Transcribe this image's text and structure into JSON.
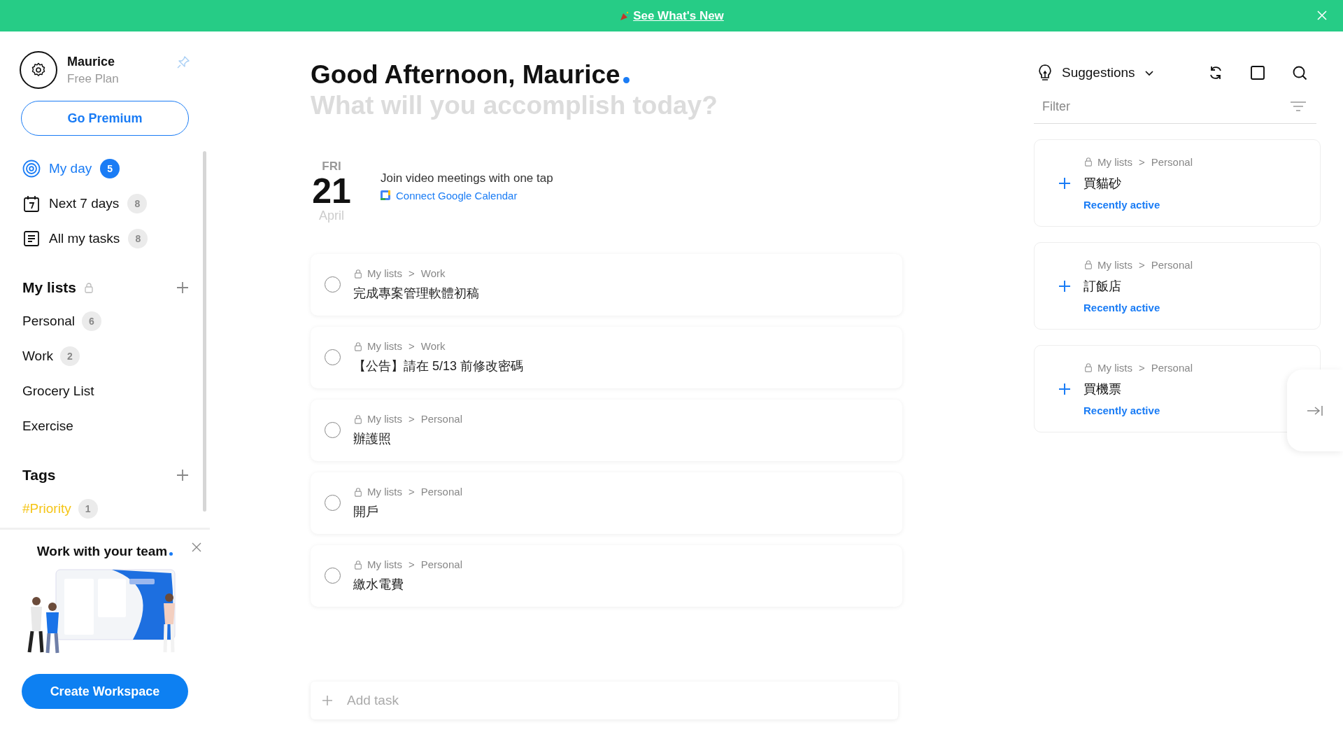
{
  "banner": {
    "text": "See What's New"
  },
  "profile": {
    "name": "Maurice",
    "plan": "Free Plan"
  },
  "premium_button": "Go Premium",
  "nav": [
    {
      "kind": "target",
      "label": "My day",
      "count": "5",
      "selected": true
    },
    {
      "kind": "calendar",
      "label": "Next 7 days",
      "count": "8",
      "selected": false
    },
    {
      "kind": "list",
      "label": "All my tasks",
      "count": "8",
      "selected": false
    }
  ],
  "my_lists": {
    "title": "My lists",
    "items": [
      {
        "label": "Personal",
        "count": "6"
      },
      {
        "label": "Work",
        "count": "2"
      },
      {
        "label": "Grocery List"
      },
      {
        "label": "Exercise"
      }
    ]
  },
  "tags": {
    "title": "Tags",
    "items": [
      {
        "label": "#Priority",
        "count": "1",
        "color": "#f5c518"
      }
    ]
  },
  "promo": {
    "title": "Work with your team",
    "button": "Create Workspace"
  },
  "greeting": {
    "title": "Good Afternoon, Maurice",
    "subtitle": "What will you accomplish today?"
  },
  "date": {
    "weekday": "FRI",
    "day": "21",
    "month": "April"
  },
  "calendar_prompt": {
    "text": "Join video meetings with one tap",
    "link": "Connect Google Calendar"
  },
  "tasks": [
    {
      "path": [
        "My lists",
        ">",
        "Work"
      ],
      "title": "完成專案管理軟體初稿",
      "checked": false
    },
    {
      "path": [
        "My lists",
        ">",
        "Work"
      ],
      "title": "【公告】請在 5/13 前修改密碼",
      "checked": false
    },
    {
      "path": [
        "My lists",
        ">",
        "Personal"
      ],
      "title": "辦護照",
      "checked": false
    },
    {
      "path": [
        "My lists",
        ">",
        "Personal"
      ],
      "title": "開戶",
      "checked": false
    },
    {
      "path": [
        "My lists",
        ">",
        "Personal"
      ],
      "title": "繳水電費",
      "checked": false
    }
  ],
  "add_task": {
    "placeholder": "Add task"
  },
  "suggestions": {
    "title": "Suggestions",
    "filter_placeholder": "Filter",
    "items": [
      {
        "path": [
          "My lists",
          ">",
          "Personal"
        ],
        "title": "買貓砂",
        "note": "Recently active"
      },
      {
        "path": [
          "My lists",
          ">",
          "Personal"
        ],
        "title": "訂飯店",
        "note": "Recently active"
      },
      {
        "path": [
          "My lists",
          ">",
          "Personal"
        ],
        "title": "買機票",
        "note": "Recently active"
      }
    ]
  }
}
